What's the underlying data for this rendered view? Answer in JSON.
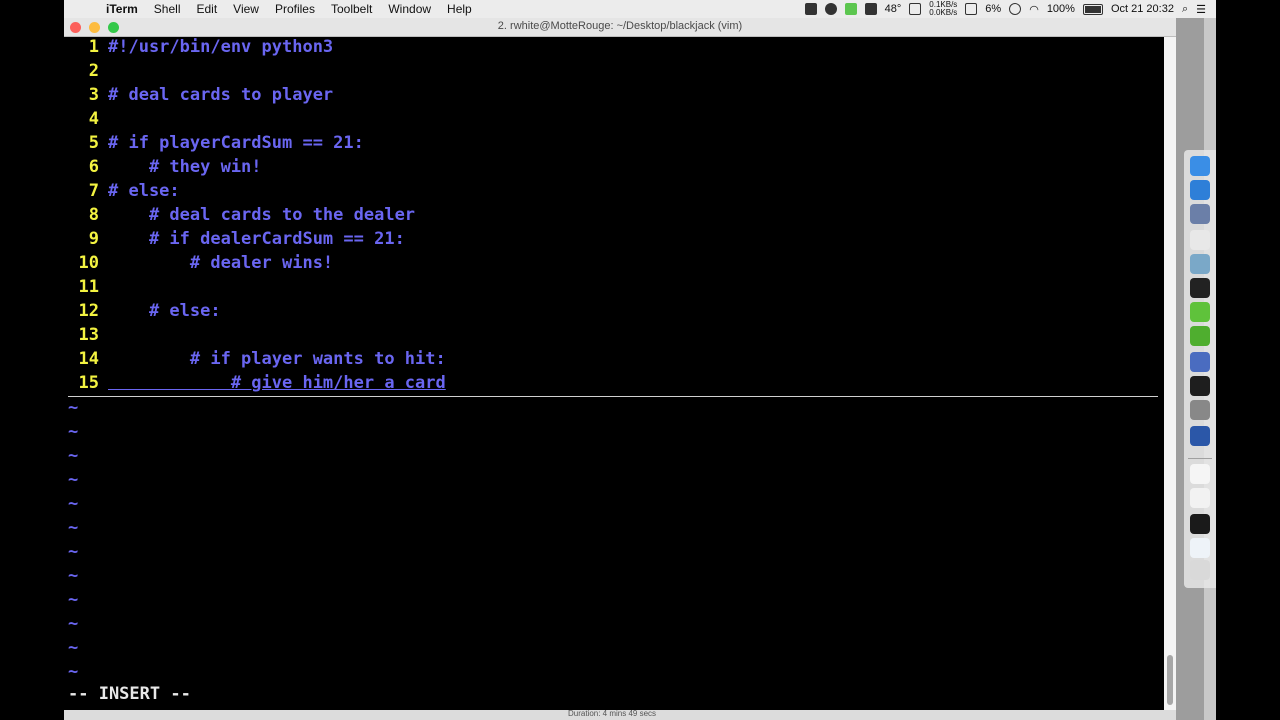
{
  "menubar": {
    "apple_glyph": "",
    "items": [
      "iTerm",
      "Shell",
      "Edit",
      "View",
      "Profiles",
      "Toolbelt",
      "Window",
      "Help"
    ],
    "status": {
      "temperature": "48°",
      "net_up": "0.1KB/s",
      "net_down": "0.0KB/s",
      "cpu": "6%",
      "battery": "100%",
      "datetime": "Oct 21  20:32"
    }
  },
  "window": {
    "title": "2. rwhite@MotteRouge: ~/Desktop/blackjack (vim)"
  },
  "vim": {
    "lines": [
      {
        "num": "1",
        "text": "#!/usr/bin/env python3"
      },
      {
        "num": "2",
        "text": ""
      },
      {
        "num": "3",
        "text": "# deal cards to player"
      },
      {
        "num": "4",
        "text": ""
      },
      {
        "num": "5",
        "text": "# if playerCardSum == 21:"
      },
      {
        "num": "6",
        "text": "    # they win!"
      },
      {
        "num": "7",
        "text": "# else:"
      },
      {
        "num": "8",
        "text": "    # deal cards to the dealer"
      },
      {
        "num": "9",
        "text": "    # if dealerCardSum == 21:"
      },
      {
        "num": "10",
        "text": "        # dealer wins!"
      },
      {
        "num": "11",
        "text": ""
      },
      {
        "num": "12",
        "text": "    # else:"
      },
      {
        "num": "13",
        "text": ""
      },
      {
        "num": "14",
        "text": "        # if player wants to hit:"
      },
      {
        "num": "15",
        "text": "            # give him/her a card"
      }
    ],
    "tilde": "~",
    "mode": "-- INSERT --"
  },
  "bottom_status": "Duration: 4 mins 49 secs",
  "colors": {
    "line_number": "#f3f341",
    "comment": "#6a66f1",
    "background": "#000000"
  },
  "dock": {
    "icons": [
      "finder-icon",
      "safari-icon",
      "preview-icon",
      "calendar-icon",
      "photos-icon",
      "terminal-icon",
      "leaf-icon",
      "leaf-icon-2",
      "network-icon",
      "bird-icon",
      "gear-icon",
      "video-icon",
      "document-icon",
      "document-icon-2",
      "terminal-thumb-icon",
      "document-icon-3",
      "trash-icon"
    ]
  }
}
